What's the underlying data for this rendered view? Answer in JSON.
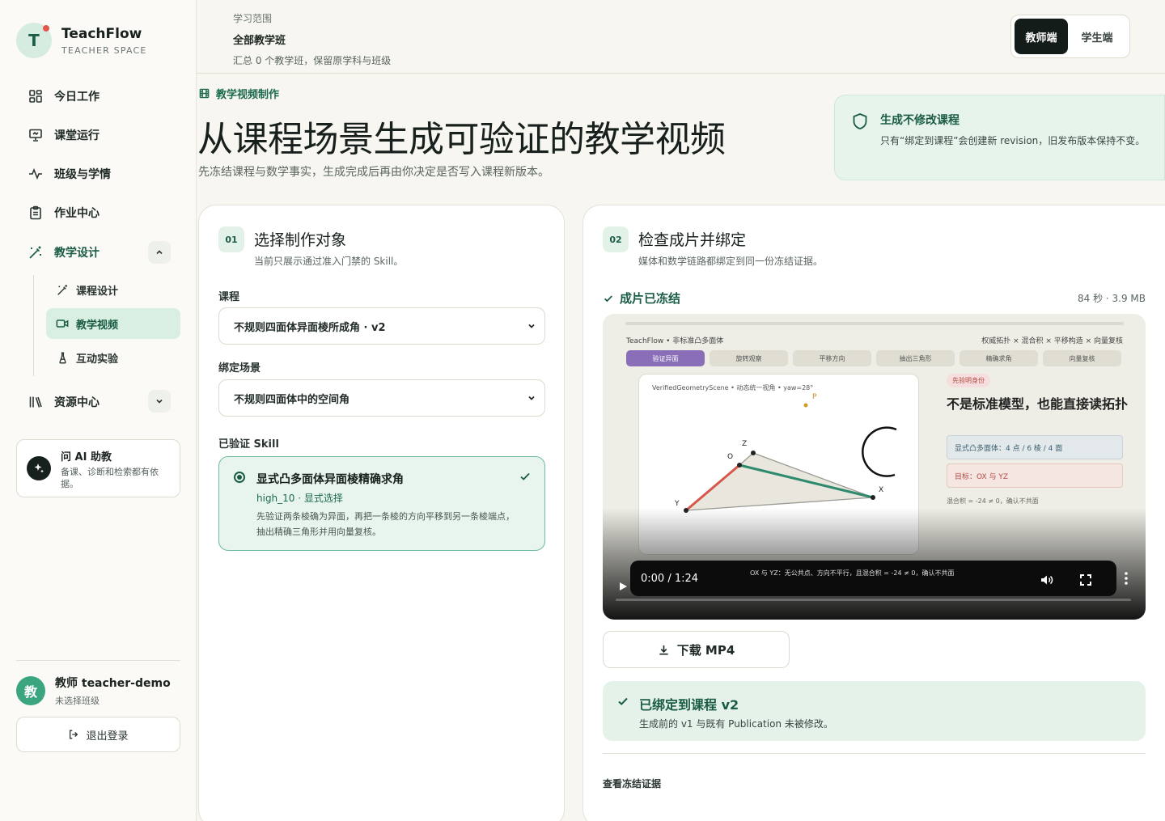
{
  "brand": {
    "logo_letter": "T",
    "name": "TeachFlow",
    "sub": "TEACHER SPACE"
  },
  "nav": {
    "today": "今日工作",
    "classroom": "课堂运行",
    "class_insight": "班级与学情",
    "homework": "作业中心",
    "teaching_design": "教学设计",
    "sub": {
      "course_design": "课程设计",
      "teaching_video": "教学视频",
      "interactive_lab": "互动实验"
    },
    "resources": "资源中心"
  },
  "ai": {
    "title": "问 AI 助教",
    "desc": "备课、诊断和检索都有依据。"
  },
  "user": {
    "avatar_letter": "教",
    "name": "教师 teacher-demo",
    "sub": "未选择班级",
    "logout": "退出登录"
  },
  "scope": {
    "label": "学习范围",
    "title": "全部教学班",
    "sub": "汇总 0 个教学班，保留原学科与班级"
  },
  "roles": {
    "teacher": "教师端",
    "student": "学生端"
  },
  "hero": {
    "eyebrow": "教学视频制作",
    "title": "从课程场景生成可验证的教学视频",
    "sub": "先冻结课程与数学事实，生成完成后再由你决定是否写入课程新版本。"
  },
  "notice": {
    "title": "生成不修改课程",
    "desc": "只有“绑定到课程”会创建新 revision，旧发布版本保持不变。"
  },
  "step1": {
    "num": "01",
    "title": "选择制作对象",
    "sub": "当前只展示通过准入门禁的 Skill。",
    "course_label": "课程",
    "course_value": "不规则四面体异面棱所成角 · v2",
    "scene_label": "绑定场景",
    "scene_value": "不规则四面体中的空间角",
    "skill_label": "已验证 Skill",
    "skill": {
      "title": "显式凸多面体异面棱精确求角",
      "meta": "high_10 · 显式选择",
      "desc": "先验证两条棱确为异面，再把一条棱的方向平移到另一条棱端点，抽出精确三角形并用向量复核。"
    }
  },
  "step2": {
    "num": "02",
    "title": "检查成片并绑定",
    "sub": "媒体和数学链路都绑定到同一份冻结证据。",
    "frozen_label": "成片已冻结",
    "frozen_meta": "84 秒 · 3.9 MB",
    "video": {
      "head": "TeachFlow • 非标准凸多面体",
      "head_right": "权威拓扑 × 混合积 × 平移构造 × 向量复核",
      "tabs": [
        "验证异面",
        "旋转观察",
        "平移方向",
        "抽出三角形",
        "精确求角",
        "向量复核"
      ],
      "scene_label": "VerifiedGeometryScene • 动态统一视角 • yaw=28°",
      "point_p": "P",
      "point_z": "Z",
      "point_o": "O",
      "point_y": "Y",
      "point_x": "X",
      "pill": "先验明身份",
      "title": "不是标准模型，也能直接读拓扑",
      "box_blue": "显式凸多面体：4 点 / 6 棱 / 4 面",
      "box_red": "目标：OX 与 YZ",
      "note": "混合积 = -24 ≠ 0，确认不共面",
      "caption": "OX 与 YZ：无公共点、方向不平行，且混合积 = -24 ≠ 0，确认不共面",
      "time": "0:00 / 1:24",
      "progress": 0
    },
    "download": "下载 MP4",
    "bound_title": "已绑定到课程 v2",
    "bound_desc": "生成前的 v1 与既有 Publication 未被修改。",
    "evidence": "查看冻结证据"
  },
  "colors": {
    "accent": "#1a5c44",
    "accent_bg": "#e5f2ea",
    "dark": "#141c1a"
  }
}
